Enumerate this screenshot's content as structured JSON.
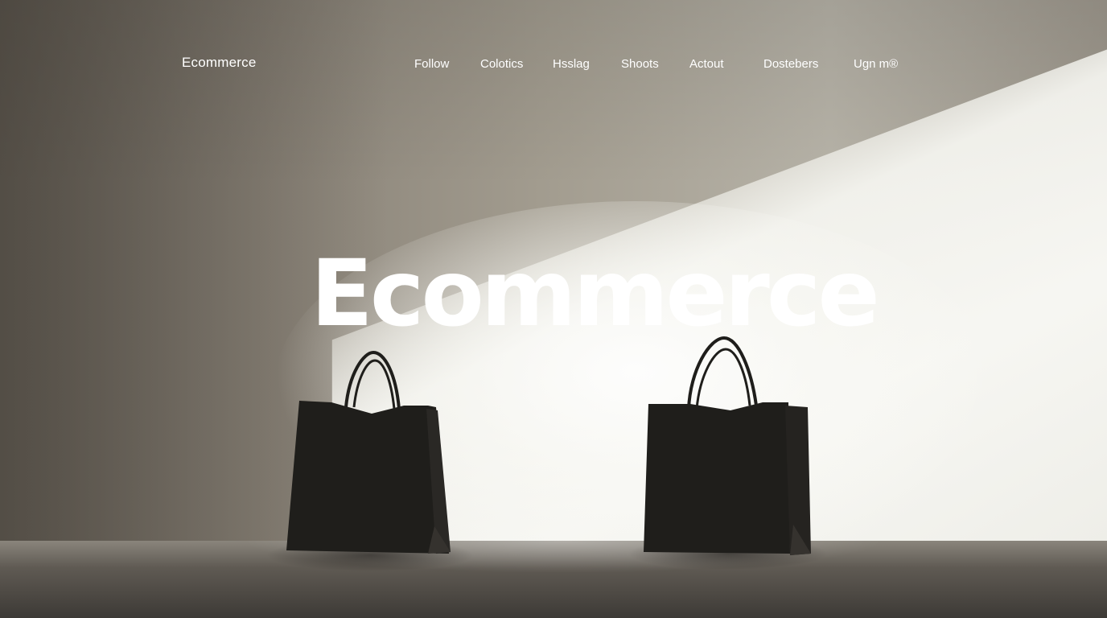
{
  "header": {
    "brand": "Ecommerce"
  },
  "nav": {
    "items": [
      {
        "label": "Follow"
      },
      {
        "label": "Colotics"
      },
      {
        "label": "Hsslag"
      },
      {
        "label": "Shoots"
      },
      {
        "label": "Actout"
      },
      {
        "label": "Dostebers"
      },
      {
        "label": "Ugn m®"
      }
    ]
  },
  "hero": {
    "title": "Ecommerce",
    "icons": [
      "shopping-bag-icon",
      "shopping-bag-icon"
    ]
  },
  "colors": {
    "text": "#ffffff",
    "bag": "#1f1e1b",
    "wall_dark": "#6f6960",
    "wall_light": "#f4f4ef"
  }
}
